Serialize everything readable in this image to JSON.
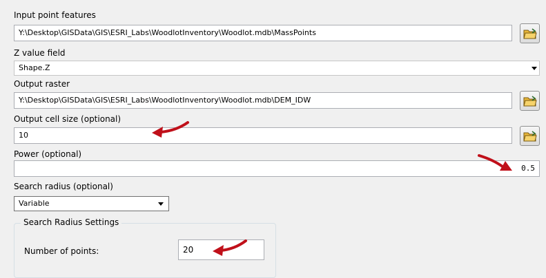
{
  "form": {
    "input_point_features": {
      "label": "Input point features",
      "value": "Y:\\Desktop\\GISData\\GIS\\ESRI_Labs\\WoodlotInventory\\Woodlot.mdb\\MassPoints"
    },
    "z_value_field": {
      "label": "Z value field",
      "value": "Shape.Z"
    },
    "output_raster": {
      "label": "Output raster",
      "value": "Y:\\Desktop\\GISData\\GIS\\ESRI_Labs\\WoodlotInventory\\Woodlot.mdb\\DEM_IDW"
    },
    "output_cell_size": {
      "label": "Output cell size (optional)",
      "value": "10"
    },
    "power": {
      "label": "Power (optional)",
      "value": "0.5"
    },
    "search_radius": {
      "label": "Search radius (optional)",
      "value": "Variable"
    },
    "search_radius_settings": {
      "title": "Search Radius Settings",
      "number_of_points_label": "Number of points:",
      "number_of_points_value": "20"
    }
  },
  "icons": {
    "browse": "open-folder-icon",
    "dropdown": "chevron-down-icon",
    "annotation": "red-arrow-icon"
  },
  "colors": {
    "annotation_arrow": "#c0101a",
    "folder_icon": "#e8b73a"
  }
}
